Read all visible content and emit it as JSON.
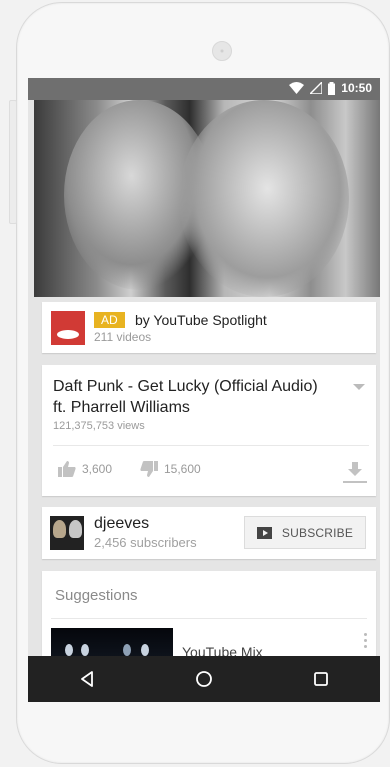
{
  "status_bar": {
    "time": "10:50",
    "icons": [
      "wifi-icon",
      "signal-icon",
      "battery-icon"
    ]
  },
  "ad": {
    "badge": "AD",
    "by": "by YouTube Spotlight",
    "videos": "211 videos",
    "logo": "youtube-spotlight-logo"
  },
  "video": {
    "title": "Daft Punk - Get Lucky (Official Audio) ft. Pharrell Williams",
    "views": "121,375,753 views",
    "likes": "3,600",
    "dislikes": "15,600",
    "icons": [
      "like-icon",
      "dislike-icon",
      "download-icon",
      "expand-chevron-icon"
    ]
  },
  "channel": {
    "name": "djeeves",
    "subscribers": "2,456 subscribers",
    "subscribe_label": "SUBSCRIBE"
  },
  "suggestions": {
    "title": "Suggestions",
    "items": [
      {
        "title": "YouTube Mix"
      }
    ]
  },
  "nav": {
    "icons": [
      "back-icon",
      "home-icon",
      "recents-icon"
    ]
  },
  "colors": {
    "ad_badge": "#e8b321",
    "logo_red": "#d13a35",
    "status_bar": "#6f6f6f",
    "nav_bar": "#222222"
  }
}
